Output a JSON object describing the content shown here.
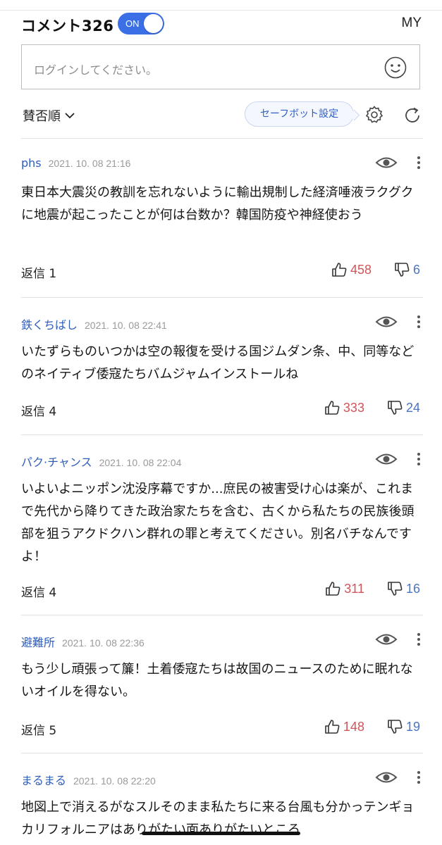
{
  "header": {
    "title": "コメント326",
    "toggle_label": "ON",
    "my_label": "MY"
  },
  "comment_input": {
    "placeholder": "ログインしてください。"
  },
  "toolbar": {
    "sort_label": "賛否順",
    "safebot_label": "セーフボット設定"
  },
  "comments": [
    {
      "author": "phs",
      "date": "2021. 10. 08 21:16",
      "body": "東日本大震災の教訓を忘れないように輸出規制した経済唾液ラクグクに地震が起こったことが何は台数か？韓国防疫や神経使おう",
      "reply": "返信 1",
      "likes": "458",
      "dislikes": "6"
    },
    {
      "author": "鉄くちばし",
      "date": "2021. 10. 08 22:41",
      "body": "いたずらものいつかは空の報復を受ける国ジムダン条、中、同等などのネイティブ倭寇たちバムジャムインストールね",
      "reply": "返信 4",
      "likes": "333",
      "dislikes": "24"
    },
    {
      "author": "パク·チャンス",
      "date": "2021. 10. 08 22:04",
      "body": "いよいよニッポン沈没序幕ですか...庶民の被害受け心は楽が、これまで先代から降りてきた政治家たちを含む、古くから私たちの民族後頭部を狙うアクドクハン群れの罪と考えてください。別名バチなんですよ！",
      "reply": "返信 4",
      "likes": "311",
      "dislikes": "16"
    },
    {
      "author": "避難所",
      "date": "2021. 10. 08 22:36",
      "body": "もう少し頑張って簾！土着倭寇たちは故国のニュースのために眠れないオイルを得ない。",
      "reply": "返信 5",
      "likes": "148",
      "dislikes": "19"
    },
    {
      "author": "まるまる",
      "date": "2021. 10. 08 22:20",
      "body": "地図上で消えるがなスルそのまま私たちに来る台風も分かっテンギョカリフォルニアはありがたい面ありがたいところ"
    }
  ],
  "colors": {
    "accent": "#3b6fe6",
    "author": "#2f5db8",
    "likes": "#d0555a",
    "dislikes": "#4a74c4"
  }
}
